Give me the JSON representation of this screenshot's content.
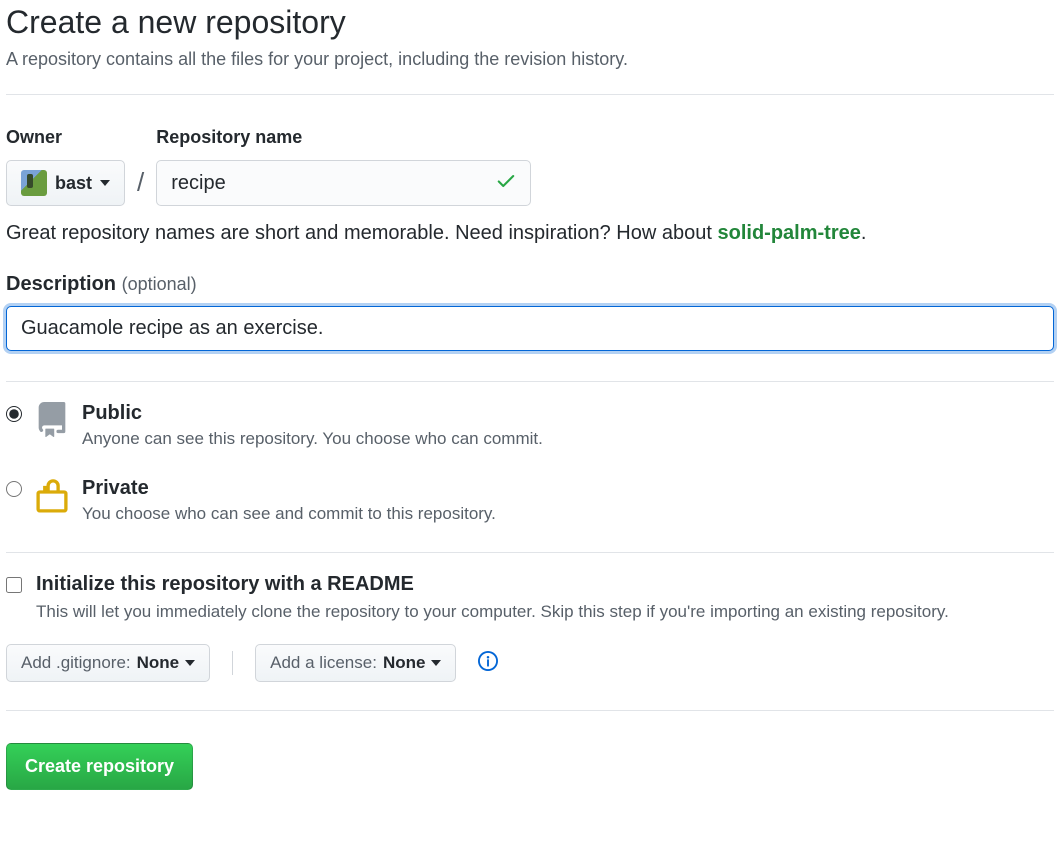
{
  "header": {
    "title": "Create a new repository",
    "subtitle": "A repository contains all the files for your project, including the revision history."
  },
  "owner": {
    "label": "Owner",
    "username": "bast"
  },
  "repo_name": {
    "label": "Repository name",
    "value": "recipe"
  },
  "hint": {
    "prefix": "Great repository names are short and memorable. Need inspiration? How about ",
    "suggestion": "solid-palm-tree",
    "suffix": "."
  },
  "description": {
    "label": "Description",
    "optional": "(optional)",
    "value": "Guacamole recipe as an exercise."
  },
  "visibility": {
    "public": {
      "title": "Public",
      "desc": "Anyone can see this repository. You choose who can commit.",
      "selected": true
    },
    "private": {
      "title": "Private",
      "desc": "You choose who can see and commit to this repository.",
      "selected": false
    }
  },
  "initialize": {
    "title": "Initialize this repository with a README",
    "desc": "This will let you immediately clone the repository to your computer. Skip this step if you're importing an existing repository.",
    "checked": false
  },
  "gitignore": {
    "label_prefix": "Add .gitignore: ",
    "value": "None"
  },
  "license": {
    "label_prefix": "Add a license: ",
    "value": "None"
  },
  "submit": {
    "label": "Create repository"
  }
}
